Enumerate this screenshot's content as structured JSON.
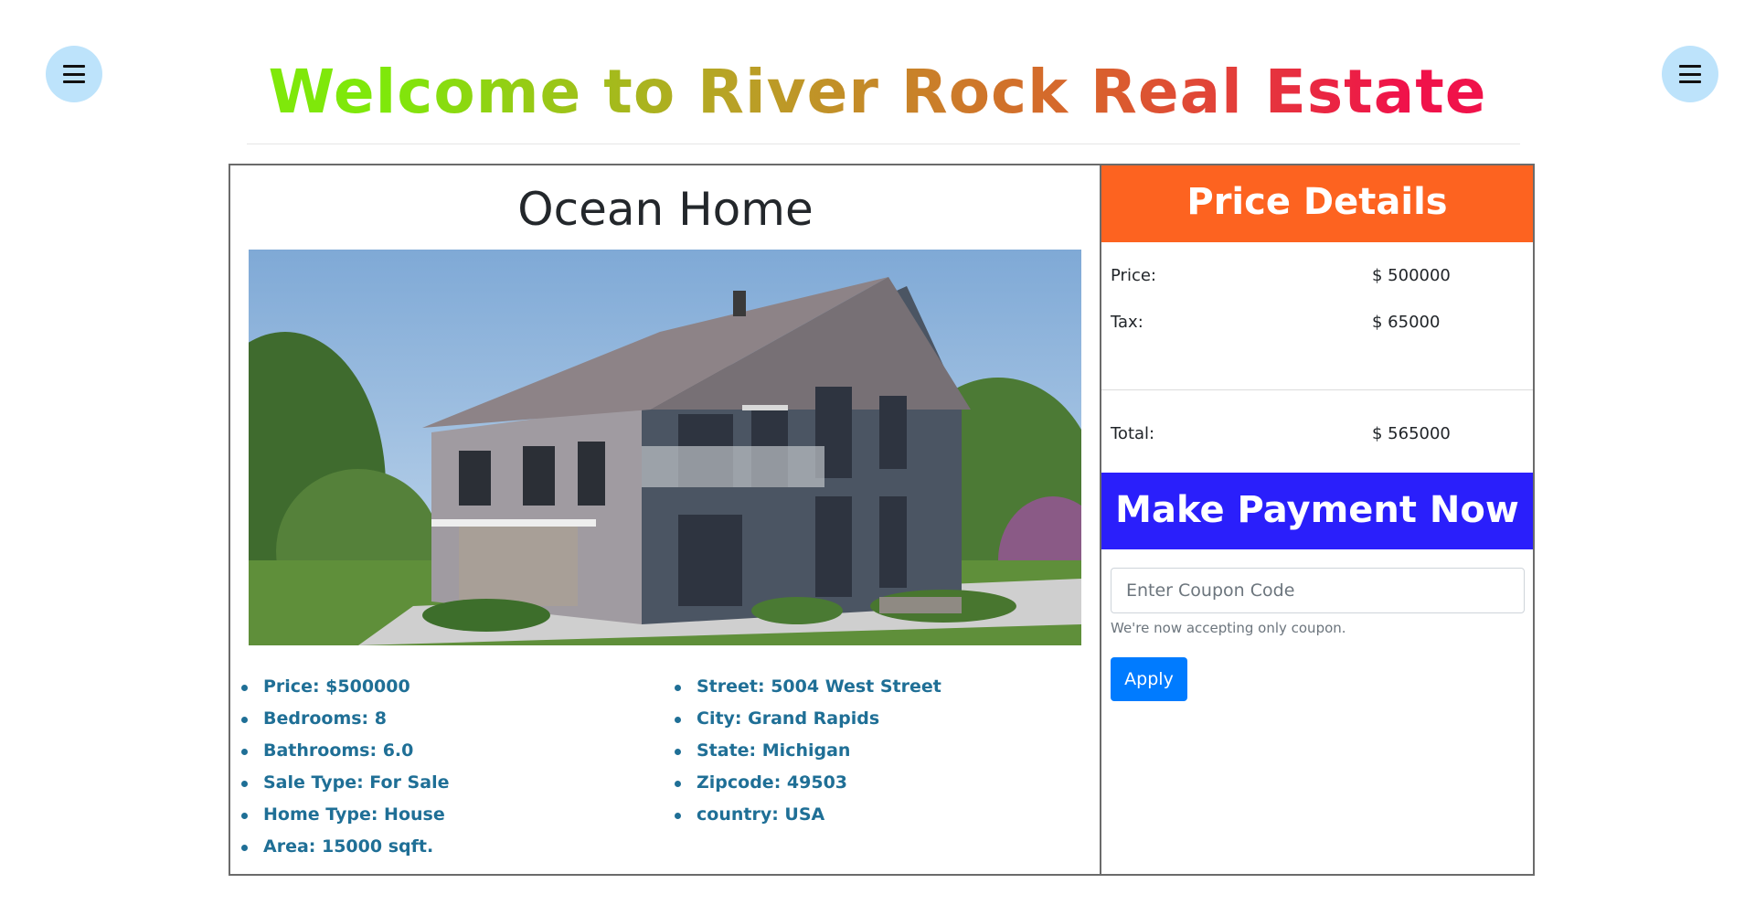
{
  "header": {
    "title": "Welcome to River Rock Real Estate",
    "left_menu_icon": "hamburger-menu-icon",
    "right_menu_icon": "hamburger-menu-icon"
  },
  "listing": {
    "title": "Ocean Home",
    "image_description": "photo of a modern two-storey house with grey siding and pitched roof",
    "details_left": [
      "Price: $500000",
      "Bedrooms: 8",
      "Bathrooms: 6.0",
      "Sale Type: For Sale",
      "Home Type: House",
      "Area: 15000 sqft."
    ],
    "details_right": [
      "Street: 5004 West Street",
      "City: Grand Rapids",
      "State: Michigan",
      "Zipcode: 49503",
      "country: USA"
    ]
  },
  "price_details": {
    "heading": "Price Details",
    "rows": [
      {
        "label": "Price:",
        "value": "$ 500000"
      },
      {
        "label": "Tax:",
        "value": "$ 65000"
      }
    ],
    "total": {
      "label": "Total:",
      "value": "$ 565000"
    }
  },
  "payment": {
    "heading": "Make Payment Now",
    "coupon_placeholder": "Enter Coupon Code",
    "coupon_value": "",
    "help_text": "We're now accepting only coupon.",
    "apply_label": "Apply"
  },
  "colors": {
    "price_header": "#fd6320",
    "payment_header": "#2a1ffb",
    "apply_button": "#007bff",
    "detail_text": "#1f6f96",
    "menu_button": "#bde3fb"
  }
}
